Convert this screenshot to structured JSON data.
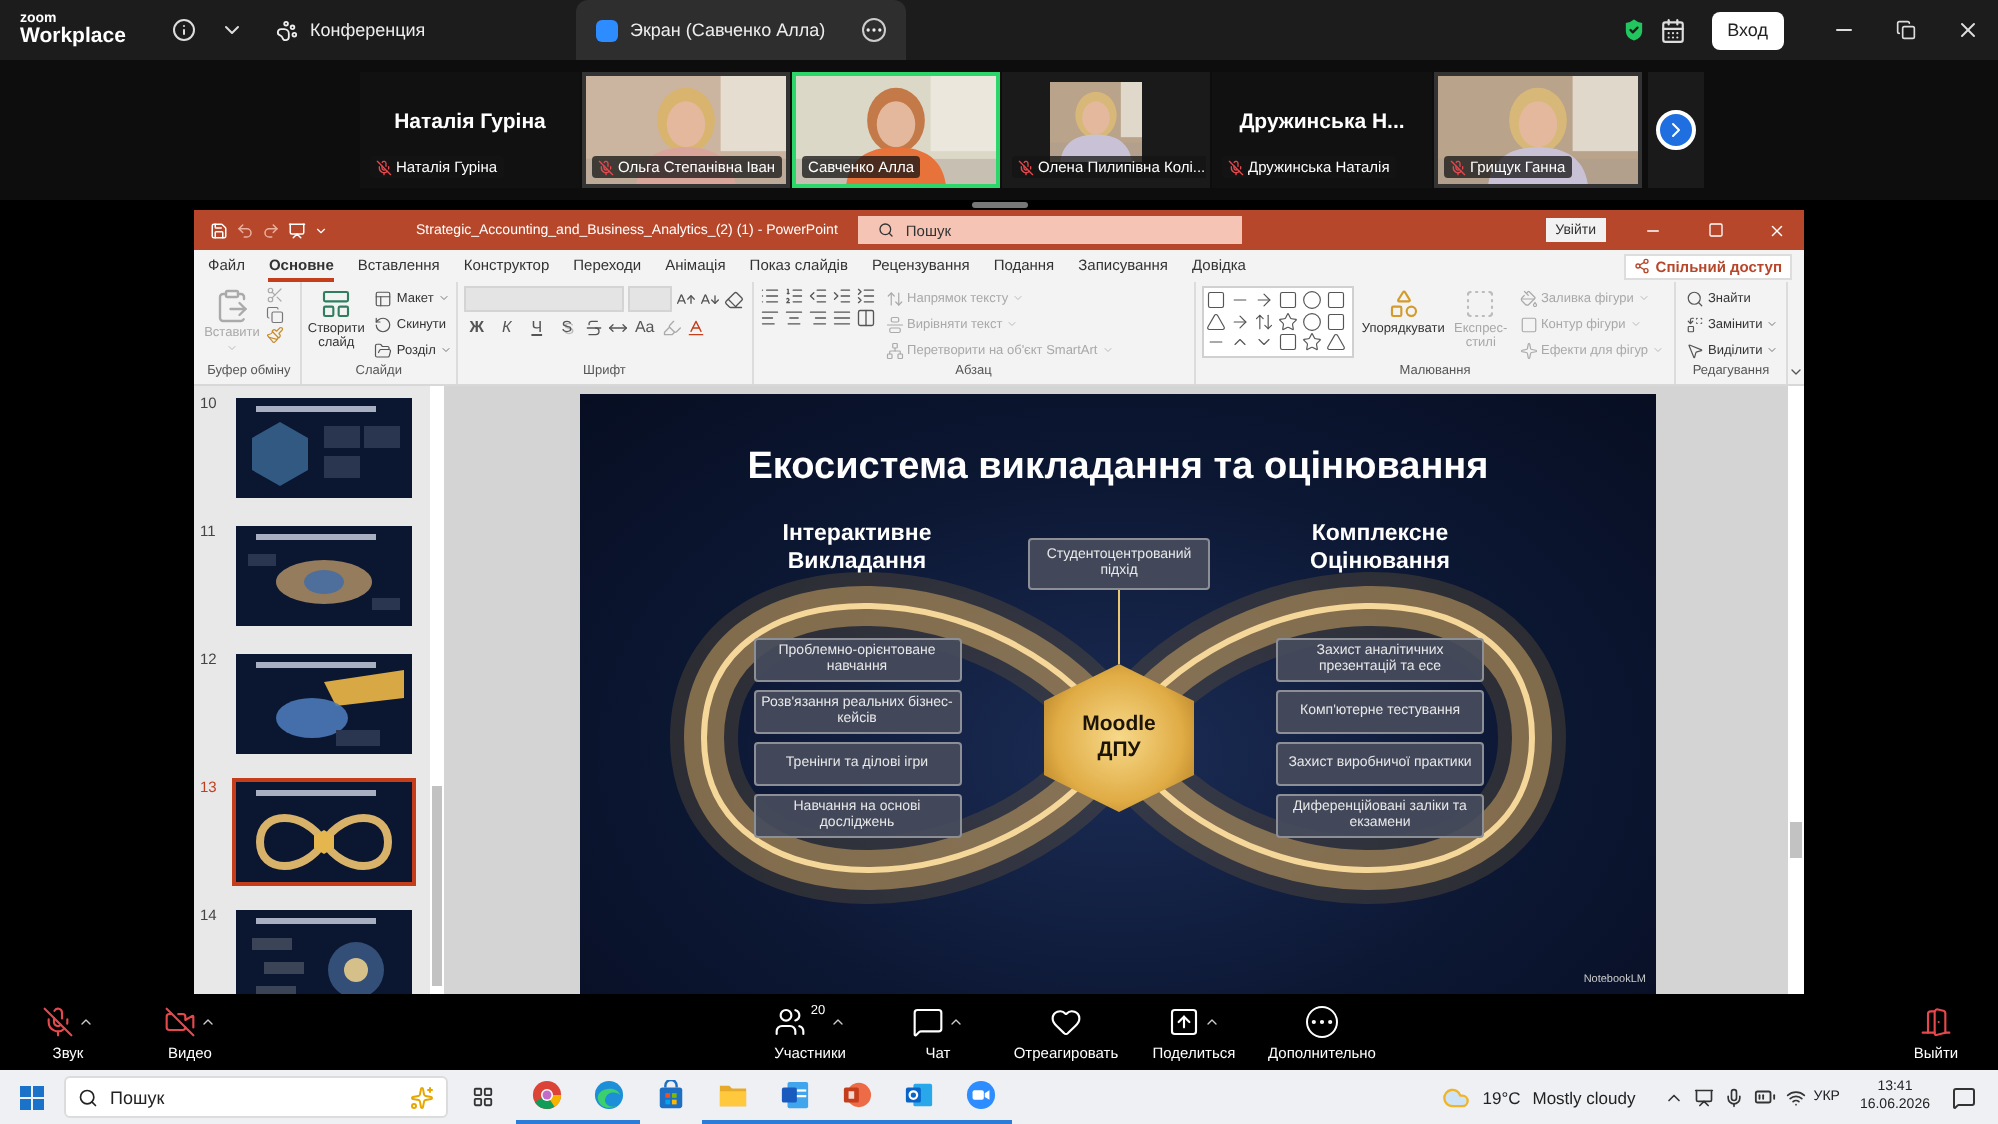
{
  "zoom_bar": {
    "logo_top": "zoom",
    "logo_bottom": "Workplace",
    "tabs": [
      {
        "kind": "meeting",
        "label": "Конференция",
        "selected": false
      },
      {
        "kind": "screen",
        "label": "Экран (Савченко Алла)",
        "selected": true
      }
    ],
    "signin": "Вход"
  },
  "participants": [
    {
      "kind": "name",
      "title": "Наталія Гуріна",
      "label": "Наталія Гуріна",
      "muted": true,
      "selected": false
    },
    {
      "kind": "video",
      "label": "Ольга Степанівна Іван",
      "muted": true,
      "selected": false
    },
    {
      "kind": "video",
      "label": "Савченко Алла",
      "muted": false,
      "selected": true
    },
    {
      "label": "Олена Пилипівна Колі...",
      "muted": true,
      "selected": false
    },
    {
      "kind": "name",
      "title": "Дружинська Н...",
      "label": "Дружинська Наталія",
      "muted": true,
      "selected": false
    },
    {
      "kind": "video",
      "label": "Грищук Ганна",
      "muted": true,
      "selected": false
    }
  ],
  "powerpoint": {
    "title": "Strategic_Accounting_and_Business_Analytics_(2) (1)  -  PowerPoint",
    "search_placeholder": "Пошук",
    "signin": "Увійти",
    "tabs": [
      {
        "label": "Файл",
        "selected": false
      },
      {
        "label": "Основне",
        "selected": true
      },
      {
        "label": "Вставлення",
        "selected": false
      },
      {
        "label": "Конструктор",
        "selected": false
      },
      {
        "label": "Переходи",
        "selected": false
      },
      {
        "label": "Анімація",
        "selected": false
      },
      {
        "label": "Показ слайдів",
        "selected": false
      },
      {
        "label": "Рецензування",
        "selected": false
      },
      {
        "label": "Подання",
        "selected": false
      },
      {
        "label": "Записування",
        "selected": false
      },
      {
        "label": "Довідка",
        "selected": false
      }
    ],
    "share": "Спільний доступ",
    "ribbon": [
      {
        "kind": "clipboard",
        "name": "Буфер обміну",
        "items": [
          {
            "label": "Вставити",
            "disabled": true
          }
        ]
      },
      {
        "kind": "slides",
        "name": "Слайди",
        "items": [
          {
            "label": "Створити слайд",
            "disabled": false
          },
          {
            "label": "Макет",
            "disabled": false
          },
          {
            "label": "Скинути",
            "disabled": false
          },
          {
            "label": "Розділ",
            "disabled": false
          }
        ]
      },
      {
        "kind": "font",
        "name": "Шрифт",
        "items": [
          {
            "label": "Ж",
            "disabled": false
          },
          {
            "label": "К",
            "disabled": false
          },
          {
            "label": "Ч",
            "disabled": false
          },
          {
            "label": "S",
            "disabled": false
          },
          {
            "label": "Aa",
            "disabled": false
          }
        ]
      },
      {
        "kind": "paragraph",
        "name": "Абзац",
        "items": [
          {
            "label": "Напрямок тексту",
            "disabled": true
          },
          {
            "label": "Вирівняти текст",
            "disabled": true
          },
          {
            "label": "Перетворити на об'єкт SmartArt",
            "disabled": true
          }
        ]
      },
      {
        "kind": "drawing",
        "name": "Малювання",
        "items": [
          {
            "label": "Упорядкувати",
            "disabled": false
          },
          {
            "label": "Експрес-стилі",
            "disabled": true
          },
          {
            "label": "Заливка фігури",
            "disabled": true
          },
          {
            "label": "Контур фігури",
            "disabled": true
          },
          {
            "label": "Ефекти для фігур",
            "disabled": true
          }
        ]
      },
      {
        "kind": "editing",
        "name": "Редагування",
        "items": [
          {
            "label": "Знайти",
            "disabled": false
          },
          {
            "label": "Замінити",
            "disabled": false
          },
          {
            "label": "Виділити",
            "disabled": false
          }
        ]
      }
    ],
    "slides": [
      {
        "number": "10",
        "selected": false
      },
      {
        "number": "11",
        "selected": false
      },
      {
        "number": "12",
        "selected": false
      },
      {
        "number": "13",
        "selected": true
      },
      {
        "number": "14",
        "selected": false
      }
    ],
    "slide": {
      "title": "Екосистема викладання та оцінювання",
      "left_heading": "Інтерактивне\nВикладання",
      "right_heading": "Комплексне\nОцінювання",
      "center_top": "Студентоцентрований підхід",
      "center": "Moodle\nДПУ",
      "left_items": [
        "Проблемно-орієнтоване навчання",
        "Розв'язання реальних бізнес-кейсів",
        "Тренінги та ділові ігри",
        "Навчання на основі досліджень"
      ],
      "right_items": [
        "Захист аналітичних презентацій та есе",
        "Комп'ютерне тестування",
        "Захист виробничої практики",
        "Диференційовані заліки та екзамени"
      ],
      "credit": "NotebookLM"
    }
  },
  "meeting_controls": [
    {
      "kind": "audio",
      "label": "Звук",
      "off": true,
      "has_menu": true
    },
    {
      "kind": "video",
      "label": "Видео",
      "off": true,
      "has_menu": true
    },
    {
      "kind": "participants",
      "label": "Участники",
      "count": "20",
      "has_menu": true
    },
    {
      "kind": "chat",
      "label": "Чат",
      "has_menu": true
    },
    {
      "kind": "react",
      "label": "Отреагировать",
      "has_menu": false
    },
    {
      "kind": "share",
      "label": "Поделиться",
      "has_menu": true
    },
    {
      "kind": "more",
      "label": "Дополнительно",
      "has_menu": false
    },
    {
      "kind": "leave",
      "label": "Выйти",
      "has_menu": false
    }
  ],
  "taskbar": {
    "search_placeholder": "Пошук",
    "apps": [
      {
        "kind": "chrome",
        "running": true
      },
      {
        "kind": "edge",
        "running": true
      },
      {
        "kind": "store",
        "running": false
      },
      {
        "kind": "explorer",
        "running": true
      },
      {
        "kind": "word",
        "running": true
      },
      {
        "kind": "powerpoint",
        "running": true
      },
      {
        "kind": "outlook",
        "running": true
      },
      {
        "kind": "zoom",
        "running": true
      }
    ],
    "temperature": "19°C",
    "weather": "Mostly cloudy",
    "language": "УКР",
    "time": "13:41",
    "date": "16.06.2026"
  }
}
